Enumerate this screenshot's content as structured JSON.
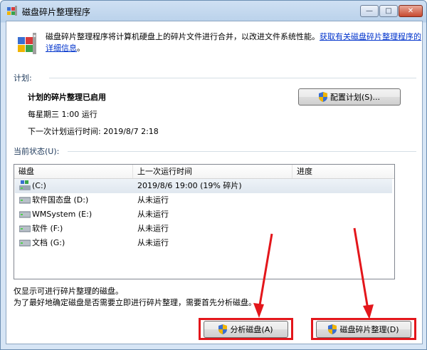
{
  "window": {
    "title": "磁盘碎片整理程序",
    "controls": {
      "minimize": "—",
      "maximize": "□",
      "close": "✕"
    }
  },
  "intro": {
    "text": "磁盘碎片整理程序将计算机硬盘上的碎片文件进行合并，以改进文件系统性能。",
    "link": "获取有关磁盘碎片整理程序的详细信息",
    "link_tail": "。"
  },
  "schedule": {
    "section_label": "计划:",
    "status": "计划的碎片整理已启用",
    "run_time": "每星期三 1:00 运行",
    "next_run": "下一次计划运行时间: 2019/8/7 2:18",
    "configure_button": "配置计划(S)..."
  },
  "current_status": {
    "section_label": "当前状态(U):",
    "columns": [
      "磁盘",
      "上一次运行时间",
      "进度"
    ],
    "rows": [
      {
        "disk": "(C:)",
        "last_run": "2019/8/6 19:00 (19% 碎片)",
        "progress": "",
        "icon": "system-drive-icon",
        "selected": true
      },
      {
        "disk": "软件国态盘 (D:)",
        "last_run": "从未运行",
        "progress": "",
        "icon": "drive-icon"
      },
      {
        "disk": "WMSystem (E:)",
        "last_run": "从未运行",
        "progress": "",
        "icon": "drive-icon"
      },
      {
        "disk": "软件 (F:)",
        "last_run": "从未运行",
        "progress": "",
        "icon": "drive-icon"
      },
      {
        "disk": "文档 (G:)",
        "last_run": "从未运行",
        "progress": "",
        "icon": "drive-icon"
      }
    ]
  },
  "notes": {
    "line1": "仅显示可进行碎片整理的磁盘。",
    "line2": "为了最好地确定磁盘是否需要立即进行碎片整理，需要首先分析磁盘。"
  },
  "actions": {
    "analyze_button": "分析磁盘(A)",
    "defrag_button": "磁盘碎片整理(D)"
  },
  "colors": {
    "highlight": "#e3161b",
    "link": "#0033cc"
  }
}
